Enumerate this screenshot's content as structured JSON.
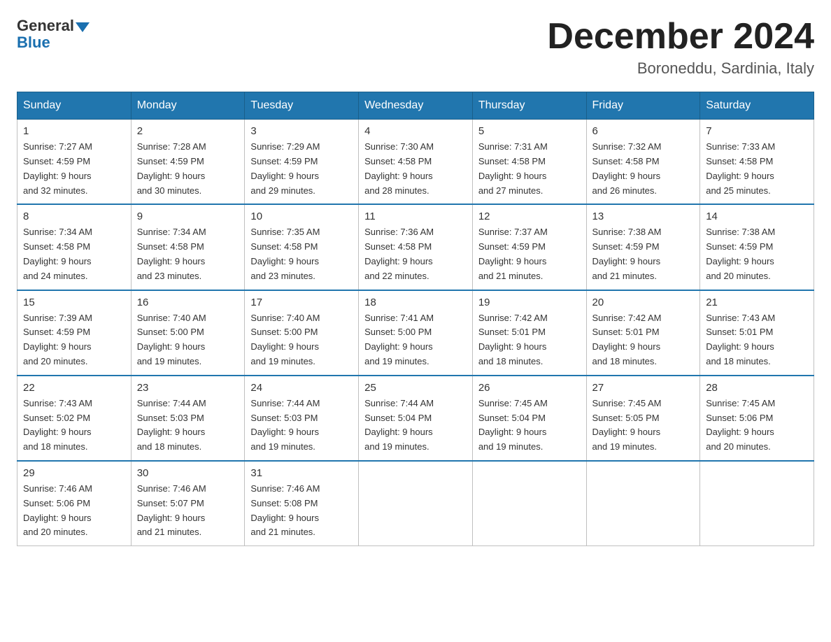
{
  "logo": {
    "text_general": "General",
    "text_blue": "Blue"
  },
  "header": {
    "month": "December 2024",
    "location": "Boroneddu, Sardinia, Italy"
  },
  "days_of_week": [
    "Sunday",
    "Monday",
    "Tuesday",
    "Wednesday",
    "Thursday",
    "Friday",
    "Saturday"
  ],
  "weeks": [
    [
      {
        "day": "1",
        "sunrise": "7:27 AM",
        "sunset": "4:59 PM",
        "daylight": "9 hours and 32 minutes."
      },
      {
        "day": "2",
        "sunrise": "7:28 AM",
        "sunset": "4:59 PM",
        "daylight": "9 hours and 30 minutes."
      },
      {
        "day": "3",
        "sunrise": "7:29 AM",
        "sunset": "4:59 PM",
        "daylight": "9 hours and 29 minutes."
      },
      {
        "day": "4",
        "sunrise": "7:30 AM",
        "sunset": "4:58 PM",
        "daylight": "9 hours and 28 minutes."
      },
      {
        "day": "5",
        "sunrise": "7:31 AM",
        "sunset": "4:58 PM",
        "daylight": "9 hours and 27 minutes."
      },
      {
        "day": "6",
        "sunrise": "7:32 AM",
        "sunset": "4:58 PM",
        "daylight": "9 hours and 26 minutes."
      },
      {
        "day": "7",
        "sunrise": "7:33 AM",
        "sunset": "4:58 PM",
        "daylight": "9 hours and 25 minutes."
      }
    ],
    [
      {
        "day": "8",
        "sunrise": "7:34 AM",
        "sunset": "4:58 PM",
        "daylight": "9 hours and 24 minutes."
      },
      {
        "day": "9",
        "sunrise": "7:34 AM",
        "sunset": "4:58 PM",
        "daylight": "9 hours and 23 minutes."
      },
      {
        "day": "10",
        "sunrise": "7:35 AM",
        "sunset": "4:58 PM",
        "daylight": "9 hours and 23 minutes."
      },
      {
        "day": "11",
        "sunrise": "7:36 AM",
        "sunset": "4:58 PM",
        "daylight": "9 hours and 22 minutes."
      },
      {
        "day": "12",
        "sunrise": "7:37 AM",
        "sunset": "4:59 PM",
        "daylight": "9 hours and 21 minutes."
      },
      {
        "day": "13",
        "sunrise": "7:38 AM",
        "sunset": "4:59 PM",
        "daylight": "9 hours and 21 minutes."
      },
      {
        "day": "14",
        "sunrise": "7:38 AM",
        "sunset": "4:59 PM",
        "daylight": "9 hours and 20 minutes."
      }
    ],
    [
      {
        "day": "15",
        "sunrise": "7:39 AM",
        "sunset": "4:59 PM",
        "daylight": "9 hours and 20 minutes."
      },
      {
        "day": "16",
        "sunrise": "7:40 AM",
        "sunset": "5:00 PM",
        "daylight": "9 hours and 19 minutes."
      },
      {
        "day": "17",
        "sunrise": "7:40 AM",
        "sunset": "5:00 PM",
        "daylight": "9 hours and 19 minutes."
      },
      {
        "day": "18",
        "sunrise": "7:41 AM",
        "sunset": "5:00 PM",
        "daylight": "9 hours and 19 minutes."
      },
      {
        "day": "19",
        "sunrise": "7:42 AM",
        "sunset": "5:01 PM",
        "daylight": "9 hours and 18 minutes."
      },
      {
        "day": "20",
        "sunrise": "7:42 AM",
        "sunset": "5:01 PM",
        "daylight": "9 hours and 18 minutes."
      },
      {
        "day": "21",
        "sunrise": "7:43 AM",
        "sunset": "5:01 PM",
        "daylight": "9 hours and 18 minutes."
      }
    ],
    [
      {
        "day": "22",
        "sunrise": "7:43 AM",
        "sunset": "5:02 PM",
        "daylight": "9 hours and 18 minutes."
      },
      {
        "day": "23",
        "sunrise": "7:44 AM",
        "sunset": "5:03 PM",
        "daylight": "9 hours and 18 minutes."
      },
      {
        "day": "24",
        "sunrise": "7:44 AM",
        "sunset": "5:03 PM",
        "daylight": "9 hours and 19 minutes."
      },
      {
        "day": "25",
        "sunrise": "7:44 AM",
        "sunset": "5:04 PM",
        "daylight": "9 hours and 19 minutes."
      },
      {
        "day": "26",
        "sunrise": "7:45 AM",
        "sunset": "5:04 PM",
        "daylight": "9 hours and 19 minutes."
      },
      {
        "day": "27",
        "sunrise": "7:45 AM",
        "sunset": "5:05 PM",
        "daylight": "9 hours and 19 minutes."
      },
      {
        "day": "28",
        "sunrise": "7:45 AM",
        "sunset": "5:06 PM",
        "daylight": "9 hours and 20 minutes."
      }
    ],
    [
      {
        "day": "29",
        "sunrise": "7:46 AM",
        "sunset": "5:06 PM",
        "daylight": "9 hours and 20 minutes."
      },
      {
        "day": "30",
        "sunrise": "7:46 AM",
        "sunset": "5:07 PM",
        "daylight": "9 hours and 21 minutes."
      },
      {
        "day": "31",
        "sunrise": "7:46 AM",
        "sunset": "5:08 PM",
        "daylight": "9 hours and 21 minutes."
      },
      null,
      null,
      null,
      null
    ]
  ],
  "labels": {
    "sunrise": "Sunrise:",
    "sunset": "Sunset:",
    "daylight": "Daylight:"
  }
}
